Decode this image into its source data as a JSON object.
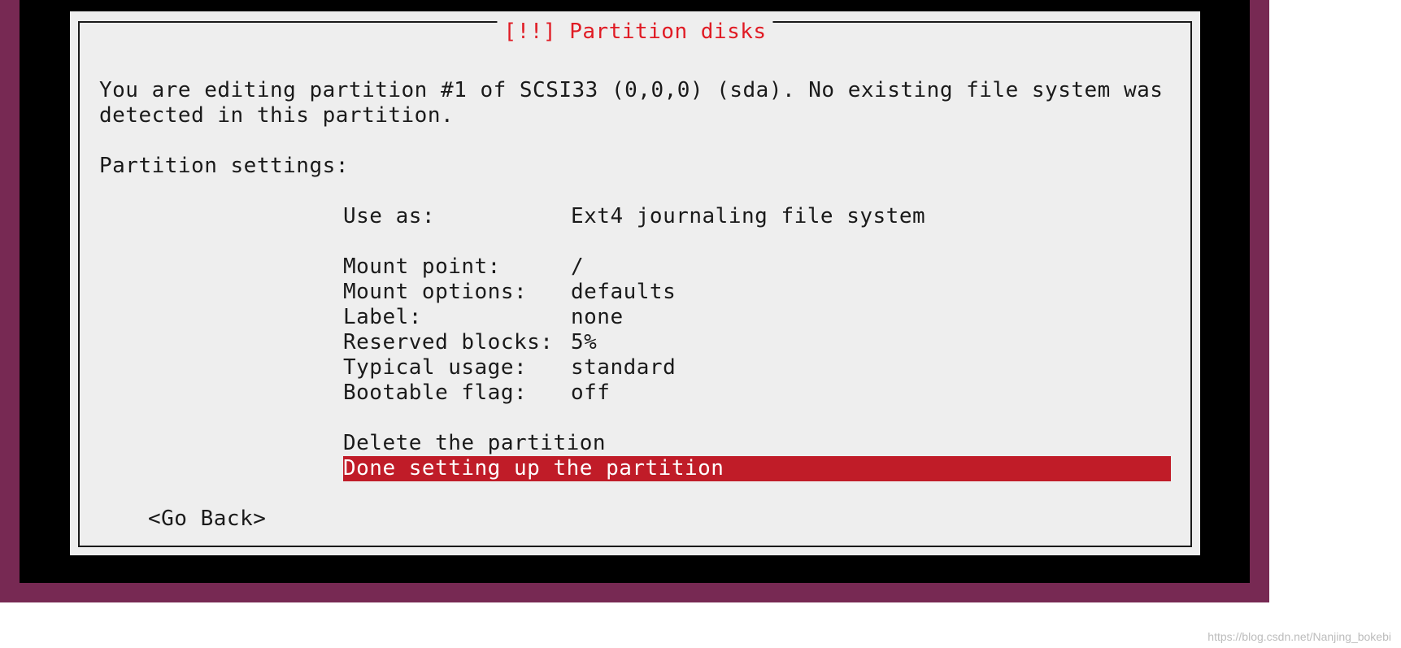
{
  "dialog": {
    "title": "[!!] Partition disks",
    "intro": "You are editing partition #1 of SCSI33 (0,0,0) (sda). No existing file system was detected in this partition.",
    "settings_label": "Partition settings:",
    "rows": [
      {
        "label": "Use as:",
        "value": "Ext4 journaling file system"
      },
      {
        "label": "Mount point:",
        "value": "/"
      },
      {
        "label": "Mount options:",
        "value": "defaults"
      },
      {
        "label": "Label:",
        "value": "none"
      },
      {
        "label": "Reserved blocks:",
        "value": "5%"
      },
      {
        "label": "Typical usage:",
        "value": "standard"
      },
      {
        "label": "Bootable flag:",
        "value": "off"
      }
    ],
    "actions": {
      "delete": "Delete the partition",
      "done": "Done setting up the partition"
    },
    "go_back": "<Go Back>"
  },
  "watermark": "https://blog.csdn.net/Nanjing_bokebi"
}
